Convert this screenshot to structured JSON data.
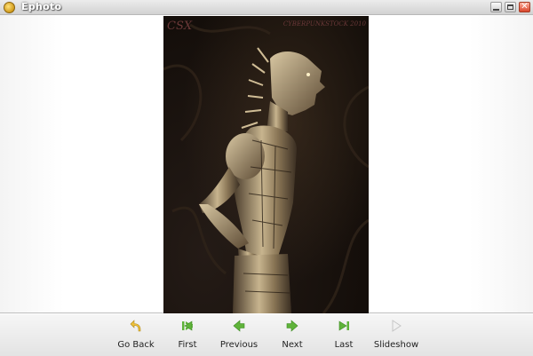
{
  "window": {
    "title": "Ephoto",
    "buttons": [
      "minimize",
      "maximize",
      "close"
    ]
  },
  "image": {
    "watermark_left": "CSX",
    "watermark_right": "CYBERPUNKSTOCK 2010"
  },
  "toolbar": {
    "go_back": {
      "label": "Go Back",
      "icon": "undo-arrow-icon"
    },
    "first": {
      "label": "First",
      "icon": "first-arrow-icon"
    },
    "previous": {
      "label": "Previous",
      "icon": "previous-arrow-icon"
    },
    "next": {
      "label": "Next",
      "icon": "next-arrow-icon"
    },
    "last": {
      "label": "Last",
      "icon": "last-arrow-icon"
    },
    "slideshow": {
      "label": "Slideshow",
      "icon": "play-icon",
      "enabled": false
    }
  },
  "colors": {
    "nav_green": "#5fb33a",
    "go_back_yellow": "#f0c23a"
  }
}
